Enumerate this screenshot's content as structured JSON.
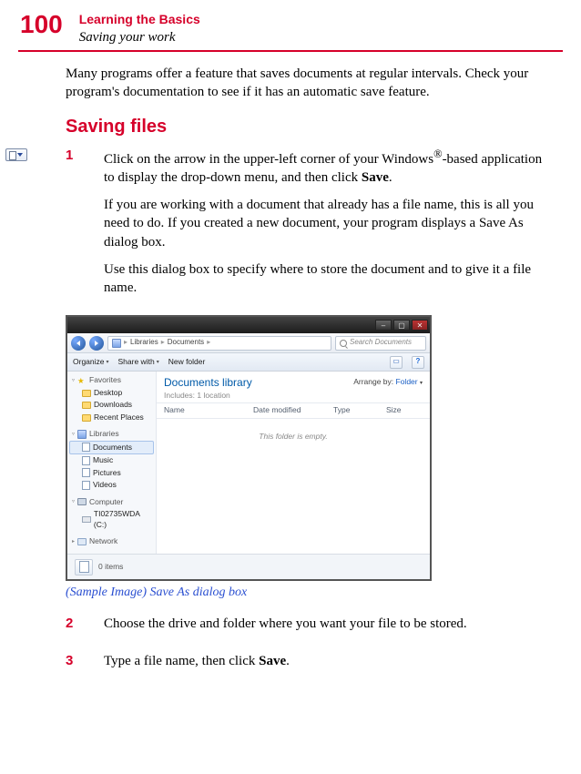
{
  "header": {
    "page_number": "100",
    "chapter": "Learning the Basics",
    "section": "Saving your work"
  },
  "intro_paragraph": "Many programs offer a feature that saves documents at regular intervals. Check your program's documentation to see if it has an automatic save feature.",
  "subsection_heading": "Saving files",
  "steps": [
    {
      "number": "1",
      "paragraphs": [
        "Click on the arrow in the upper-left corner of your Windows®-based application to display the drop-down menu, and then click Save.",
        "If you are working with a document that already has a file name, this is all you need to do. If you created a new document, your program displays a Save As dialog box.",
        "Use this dialog box to specify where to store the document and to give it a file name."
      ]
    },
    {
      "number": "2",
      "paragraphs": [
        "Choose the drive and folder where you want your file to be stored."
      ]
    },
    {
      "number": "3",
      "paragraphs": [
        "Type a file name, then click Save."
      ]
    }
  ],
  "dialog": {
    "breadcrumb": {
      "root": "Libraries",
      "current": "Documents"
    },
    "search_placeholder": "Search Documents",
    "toolbar": {
      "organize": "Organize",
      "share": "Share with",
      "newfolder": "New folder"
    },
    "sidebar": {
      "favorites_label": "Favorites",
      "favorites": [
        "Desktop",
        "Downloads",
        "Recent Places"
      ],
      "libraries_label": "Libraries",
      "libraries": [
        "Documents",
        "Music",
        "Pictures",
        "Videos"
      ],
      "computer_label": "Computer",
      "drive": "TI02735WDA (C:)",
      "network_label": "Network"
    },
    "content": {
      "library_title": "Documents library",
      "library_sub": "Includes: 1 location",
      "arrange_label": "Arrange by:",
      "arrange_value": "Folder",
      "columns": [
        "Name",
        "Date modified",
        "Type",
        "Size"
      ],
      "empty": "This folder is empty."
    },
    "footer": {
      "items": "0 items"
    }
  },
  "caption": "(Sample Image) Save As dialog box"
}
